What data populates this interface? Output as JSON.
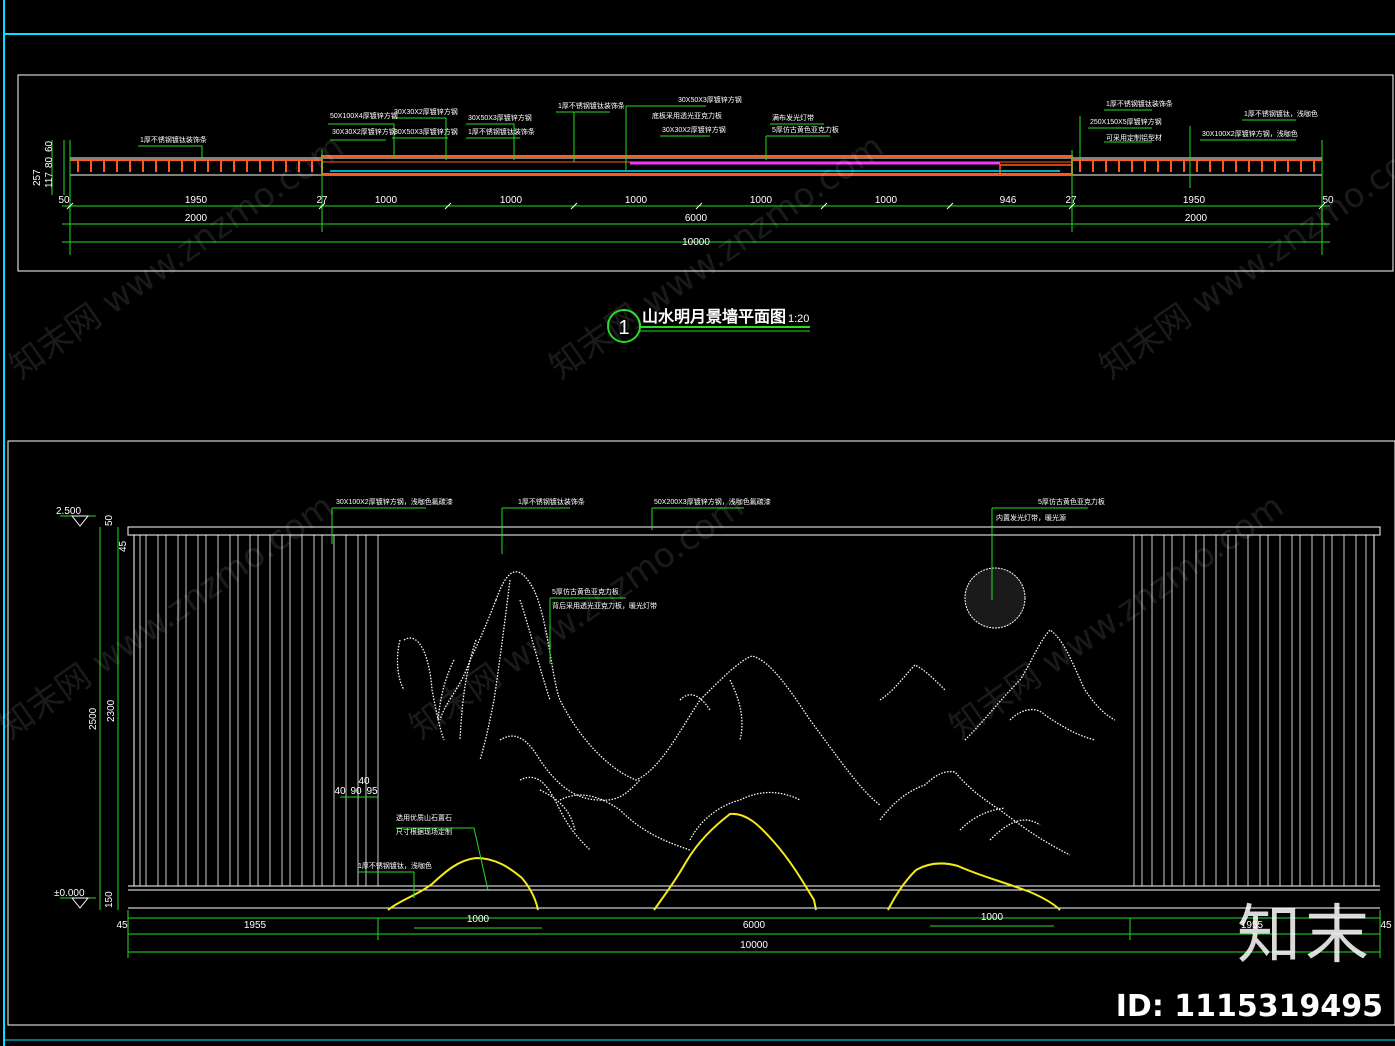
{
  "plan": {
    "title": "山水明月景墙平面图",
    "scale": "1:20",
    "section_number": "1",
    "left_dims": [
      "257",
      "117",
      "80",
      "60"
    ],
    "dims_row1": [
      "50",
      "1950",
      "27",
      "1000",
      "1000",
      "1000",
      "1000",
      "1000",
      "946",
      "27",
      "1950",
      "50"
    ],
    "dims_row2": [
      "2000",
      "6000",
      "2000"
    ],
    "dims_total": "10000",
    "annotations": [
      "1厚不锈钢镀钛装饰条",
      "50X100X4厚镀锌方钢",
      "30X30X2厚镀锌方钢",
      "30X30X2厚镀锌方钢",
      "30X50X3厚镀锌方钢",
      "30X50X3厚镀锌方钢",
      "1厚不锈钢镀钛装饰条",
      "1厚不锈钢镀钛装饰条",
      "30X50X3厚镀锌方钢",
      "底板采用透光亚克力板",
      "30X30X2厚镀锌方钢",
      "满布发光灯带",
      "5厚仿古黄色亚克力板",
      "1厚不锈钢镀钛装饰条",
      "250X150X5厚镀锌方钢",
      "可采用定制铝型材",
      "1厚不锈钢镀钛，浅咖色",
      "30X100X2厚镀锌方钢，浅咖色"
    ]
  },
  "elevation": {
    "levels": [
      "2.500",
      "±0.000"
    ],
    "left_dims": [
      "50",
      "45",
      "2500",
      "2300",
      "150"
    ],
    "small_dims": [
      "40",
      "40",
      "90",
      "95"
    ],
    "bottom_dims_row1": [
      "45",
      "1955",
      "6000",
      "1955",
      "45"
    ],
    "bottom_dims_inner": [
      "1000",
      "1000"
    ],
    "bottom_total": "10000",
    "annotations": [
      "30X100X2厚镀锌方钢，浅咖色氟碳漆",
      "1厚不锈钢镀钛装饰条",
      "50X200X3厚镀锌方钢，浅咖色氟碳漆",
      "5厚仿古黄色亚克力板",
      "背后采用透光亚克力板，暖光灯带",
      "5厚仿古黄色亚克力板",
      "内置发光灯带，暖光源",
      "选用优质山石置石",
      "尺寸根据现场定制",
      "1厚不锈钢镀钛，浅咖色"
    ]
  },
  "watermarks": [
    "知末网 www.znzmo.com"
  ],
  "brand": "知末",
  "image_id": "ID: 1115319495",
  "colors": {
    "background": "#000000",
    "frame": "#00e5ff",
    "dimension": "#22dd22",
    "steel": "#ff5a1f",
    "accent": "#ff33ff",
    "rock": "#f2ea1a",
    "line": "#ffffff"
  }
}
